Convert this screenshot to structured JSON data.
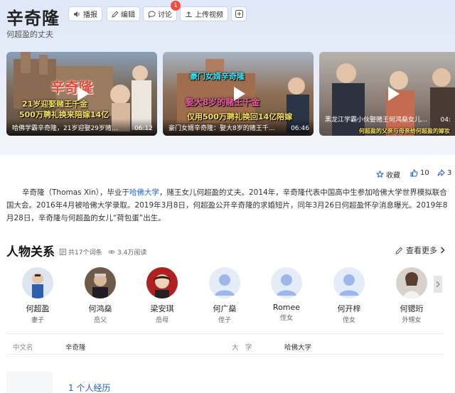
{
  "header": {
    "title": "辛奇隆",
    "subtitle": "何超盈的丈夫",
    "buttons": {
      "play": "播报",
      "edit": "编辑",
      "discuss": "讨论",
      "discuss_badge": "1",
      "upload": "上传视频"
    }
  },
  "videos": [
    {
      "caption": "哈佛学霸辛奇隆，21岁迎娶29岁赌…",
      "duration": "06:12",
      "overlay_name": "辛奇隆",
      "overlay_line1": "21岁迎娶赌王千金",
      "overlay_line2": "500万聘礼换来陪嫁14亿"
    },
    {
      "caption": "豪门女婿辛奇隆：娶大8岁的赌王千…",
      "duration": "06:46",
      "overlay_line1": "豪门女婿辛奇隆",
      "overlay_line2": "娶大8岁的赌王千金",
      "overlay_line3": "仅用500万聘礼换回14亿陪嫁"
    },
    {
      "caption": "黑龙江学霸小伙娶赌王何鸿燊女儿…",
      "duration": "04:",
      "overlay_line1": "何超盈的父亲与母亲给何超盈的嫁妆"
    }
  ],
  "actions": {
    "collect": "收藏",
    "like_count": "10",
    "share_count": "3"
  },
  "intro": {
    "p1_a": "辛奇隆（Thomas Xin），毕业于",
    "p1_link": "哈佛大学",
    "p1_b": "，赌王女儿何超盈的丈夫。2014年，辛奇隆代表中国高中生参加哈佛大学世界模拟联合国大会。2016年4月被哈佛大学录取。2019年3月8日，何超盈公开辛奇隆的求婚短片，同年3月26日何超盈怀孕消息曝光。2019年8月28日，辛奇隆与何超盈的女儿“荷包蛋”出生。"
  },
  "relations": {
    "title": "人物关系",
    "entries": "共17个词条",
    "views": "3.4万阅读",
    "more": "查看更多",
    "people": [
      {
        "name": "何超盈",
        "role": "妻子"
      },
      {
        "name": "何鸿燊",
        "role": "岳父"
      },
      {
        "name": "梁安琪",
        "role": "岳母"
      },
      {
        "name": "何广燊",
        "role": "侄子"
      },
      {
        "name": "Romee",
        "role": "侄女"
      },
      {
        "name": "何开梓",
        "role": "侄女"
      },
      {
        "name": "何锶珩",
        "role": "外甥女"
      }
    ]
  },
  "basic_info": {
    "cn_name_label": "中文名",
    "cn_name_value": "辛奇隆",
    "university_label": "大　学",
    "university_value": "哈佛大学"
  },
  "toc": {
    "first": "1 个人经历"
  },
  "colors": {
    "link": "#1f5fd8",
    "badge": "#f34c3a"
  }
}
